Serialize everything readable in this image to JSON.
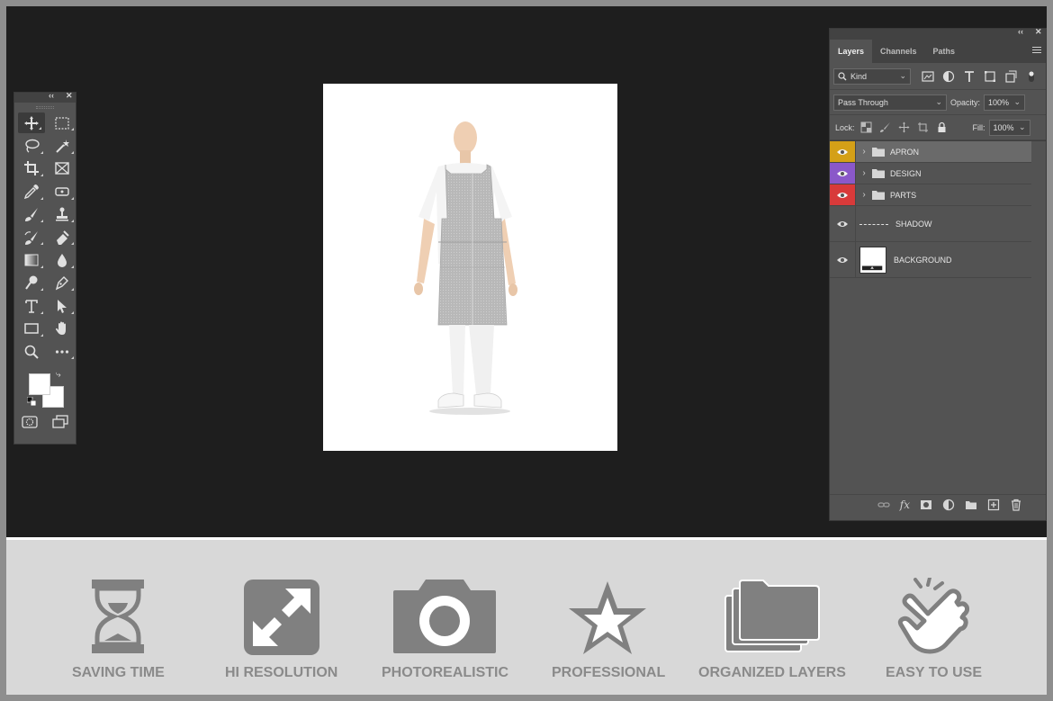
{
  "layers_panel": {
    "tabs": [
      "Layers",
      "Channels",
      "Paths"
    ],
    "filter": {
      "kind_label": "Kind"
    },
    "blend_mode": "Pass Through",
    "opacity_label": "Opacity:",
    "opacity_value": "100%",
    "lock_label": "Lock:",
    "fill_label": "Fill:",
    "fill_value": "100%",
    "layers": [
      {
        "name": "APRON",
        "type": "group",
        "tag_color": "#d4a017",
        "selected": true
      },
      {
        "name": "DESIGN",
        "type": "group",
        "tag_color": "#8a58c9"
      },
      {
        "name": "PARTS",
        "type": "group",
        "tag_color": "#d83a3a"
      },
      {
        "name": "SHADOW",
        "type": "layer"
      },
      {
        "name": "BACKGROUND",
        "type": "layer"
      }
    ]
  },
  "toolbox": {
    "tools": [
      "move-tool",
      "marquee-tool",
      "lasso-tool",
      "magic-wand-tool",
      "crop-tool",
      "frame-tool",
      "eyedropper-tool",
      "spot-healing-tool",
      "brush-tool",
      "stamp-tool",
      "history-brush-tool",
      "eraser-tool",
      "gradient-tool",
      "blur-tool",
      "dodge-tool",
      "pen-tool",
      "type-tool",
      "path-selection-tool",
      "rectangle-tool",
      "hand-tool",
      "zoom-tool",
      "more-tools"
    ],
    "foreground_color": "#ffffff",
    "background_color": "#ffffff"
  },
  "features": [
    {
      "label": "SAVING TIME",
      "icon": "hourglass-icon"
    },
    {
      "label": "HI RESOLUTION",
      "icon": "expand-icon"
    },
    {
      "label": "PHOTOREALISTIC",
      "icon": "camera-icon"
    },
    {
      "label": "PROFESSIONAL",
      "icon": "star-icon"
    },
    {
      "label": "ORGANIZED LAYERS",
      "icon": "folders-icon"
    },
    {
      "label": "EASY TO USE",
      "icon": "hand-tap-icon"
    }
  ],
  "colors": {
    "workspace": "#1e1e1e",
    "panel": "#535353",
    "feature_icon": "#808080",
    "feature_text": "#8a8a8a"
  }
}
